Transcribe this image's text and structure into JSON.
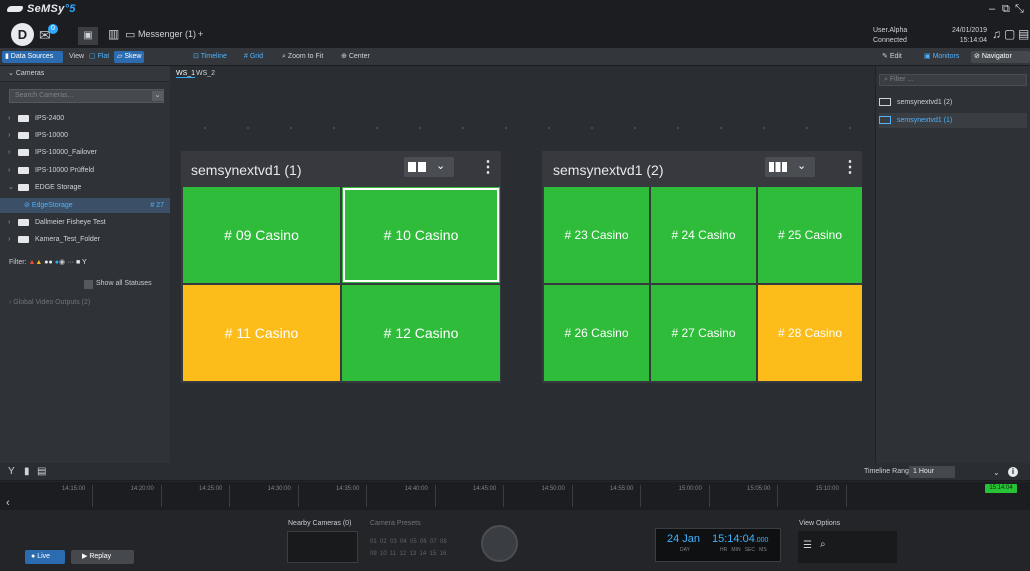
{
  "app": {
    "brand": "SeMSy",
    "brand_version": "5"
  },
  "top": {
    "messages_badge": "0",
    "messenger_tab": "Messenger (1)",
    "add_tab": "+",
    "user": "User.Alpha",
    "connection": "Connected",
    "date": "24/01/2019",
    "time": "15:14:04"
  },
  "toolbar": {
    "data_sources": "Data Sources",
    "view": "View",
    "flat": "Flat",
    "skew": "Skew",
    "timeline": "Timeline",
    "grid": "Grid",
    "zoom_to_fit": "Zoom to Fit",
    "center": "Center",
    "edit": "Edit",
    "monitors": "Monitors",
    "navigator": "Navigator"
  },
  "sidebar": {
    "header": "Cameras",
    "search_placeholder": "Search Cameras...",
    "items": [
      {
        "label": "IPS-2400",
        "count": ""
      },
      {
        "label": "IPS-10000",
        "count": ""
      },
      {
        "label": "IPS-10000_Failover",
        "count": ""
      },
      {
        "label": "IPS-10000 Prüffeld",
        "count": ""
      },
      {
        "label": "EDGE Storage",
        "count": ""
      },
      {
        "label": "EdgeStorage",
        "count": "# 27"
      },
      {
        "label": "Dallmeier Fisheye Test",
        "count": ""
      },
      {
        "label": "Kamera_Test_Folder",
        "count": ""
      }
    ],
    "filter_label": "Filter:",
    "show_all": "Show all Statuses",
    "global_outputs": "Global Video Outputs (2)"
  },
  "workspace": {
    "tabs": [
      "WS_1",
      "WS_2"
    ],
    "walls": [
      {
        "title": "semsynextvd1 (1)",
        "tiles": [
          {
            "label": "# 09 Casino",
            "status": "green"
          },
          {
            "label": "# 10 Casino",
            "status": "green"
          },
          {
            "label": "# 11 Casino",
            "status": "yellow"
          },
          {
            "label": "# 12 Casino",
            "status": "green"
          }
        ]
      },
      {
        "title": "semsynextvd1 (2)",
        "tiles": [
          {
            "label": "# 23 Casino",
            "status": "green"
          },
          {
            "label": "# 24 Casino",
            "status": "green"
          },
          {
            "label": "# 25 Casino",
            "status": "green"
          },
          {
            "label": "# 26 Casino",
            "status": "green"
          },
          {
            "label": "# 27 Casino",
            "status": "green"
          },
          {
            "label": "# 28 Casino",
            "status": "yellow"
          }
        ]
      }
    ]
  },
  "monitors": {
    "filter_placeholder": "Filter ...",
    "items": [
      "semsynextvd1 (2)",
      "semsynextvd1 (1)"
    ]
  },
  "timeline": {
    "range_label": "Timeline Range",
    "range_value": "1 Hour",
    "ticks": [
      "14:15:00",
      "14:20:00",
      "14:25:00",
      "14:30:00",
      "14:35:00",
      "14:40:00",
      "14:45:00",
      "14:50:00",
      "14:55:00",
      "15:00:00",
      "15:05:00",
      "15:10:00"
    ],
    "now": "15:14:04"
  },
  "player": {
    "nearby": "Nearby Cameras (0)",
    "presets_label": "Camera Presets",
    "presets_row1": "01  02  03  04  05  06  07  08",
    "presets_row2": "09  10  11  12  13  14  15  16",
    "clock_day": "24 Jan",
    "clock_day_sub": "DAY",
    "clock_time": "15:14:04",
    "clock_ms": ".000",
    "clock_sub": "HR   MIN   SEC   MS",
    "view_options": "View Options",
    "live": "Live",
    "replay": "Replay"
  },
  "colors": {
    "accent": "#2ea8ff",
    "tile_green": "#2ebc3a",
    "tile_yellow": "#fcbd1b"
  }
}
